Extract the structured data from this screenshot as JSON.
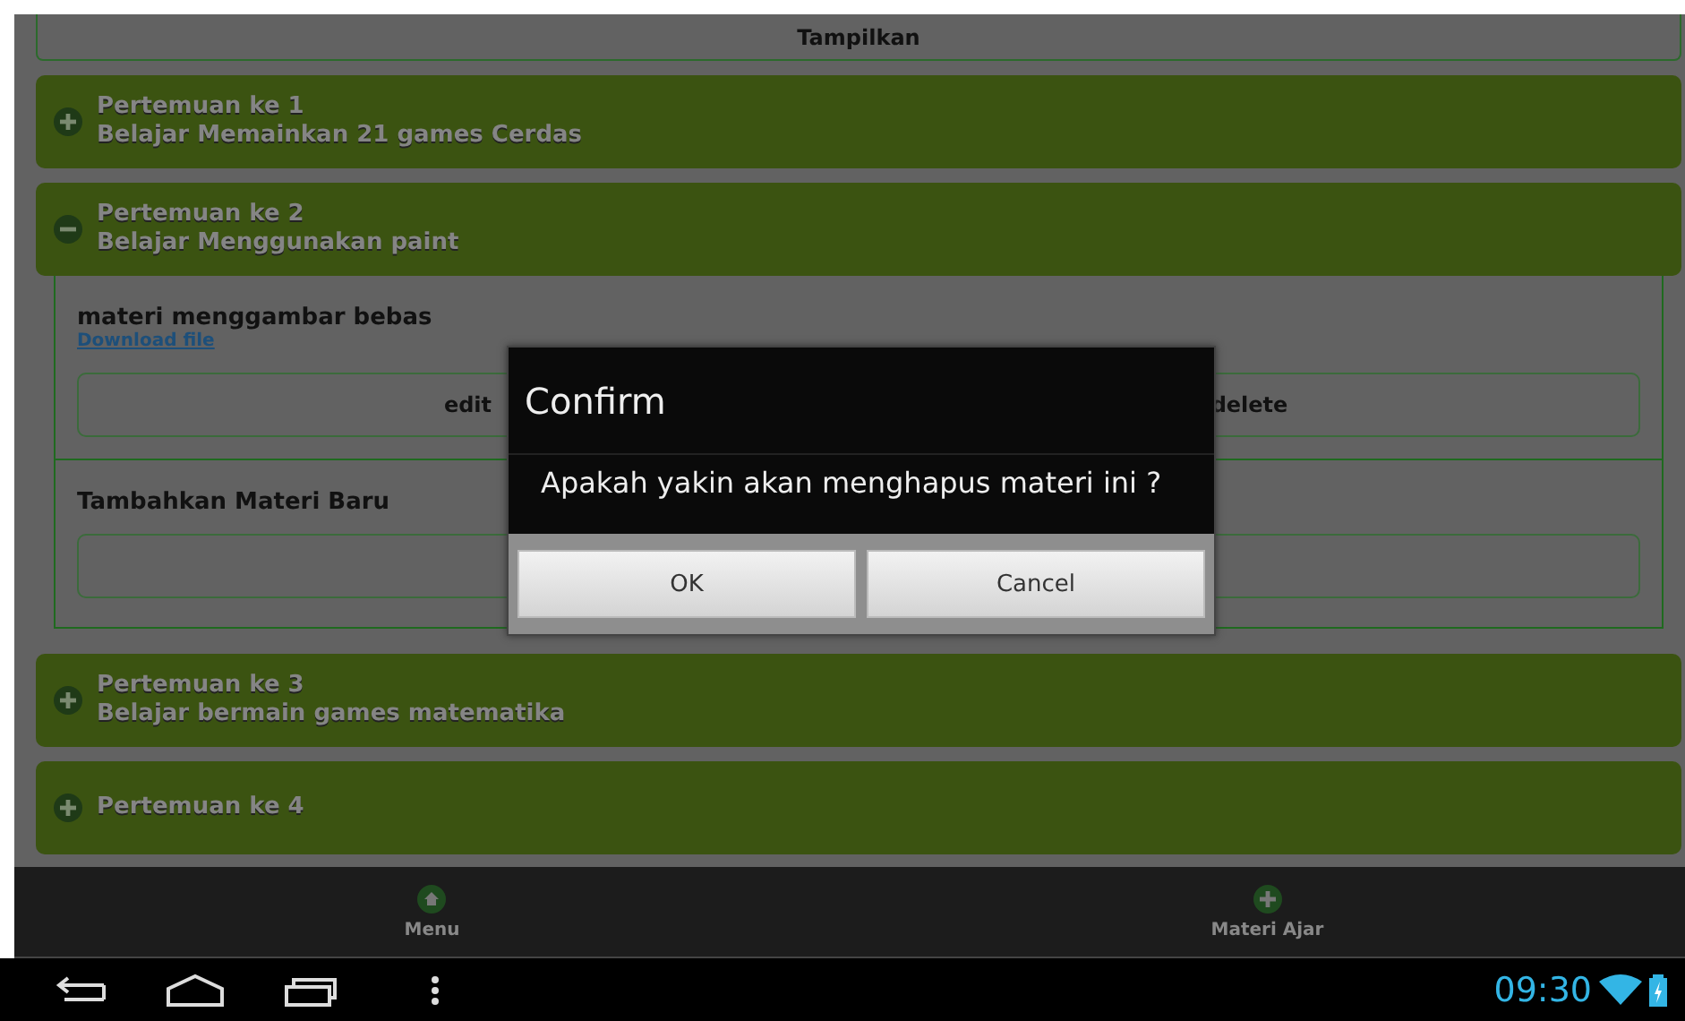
{
  "top_button": {
    "label": "Tampilkan"
  },
  "meetings": [
    {
      "title": "Pertemuan ke 1",
      "subtitle": "Belajar Memainkan 21 games Cerdas",
      "expanded": false
    },
    {
      "title": "Pertemuan ke 2",
      "subtitle": "Belajar Menggunakan paint",
      "expanded": true,
      "materials": [
        {
          "title": "materi menggambar bebas",
          "link": "Download file",
          "actions": [
            "edit",
            "delete"
          ]
        }
      ],
      "add_label": "Tambahkan Materi Baru"
    },
    {
      "title": "Pertemuan ke 3",
      "subtitle": "Belajar bermain games matematika",
      "expanded": false
    },
    {
      "title": "Pertemuan ke 4",
      "expanded": false
    }
  ],
  "dialog": {
    "title": "Confirm",
    "message": "Apakah yakin akan menghapus materi ini ?",
    "buttons": [
      "OK",
      "Cancel"
    ]
  },
  "bottom_nav": [
    {
      "label": "Menu",
      "kind": "home"
    },
    {
      "label": "Materi Ajar",
      "kind": "add"
    }
  ],
  "status_bar": {
    "time": "09:30"
  }
}
